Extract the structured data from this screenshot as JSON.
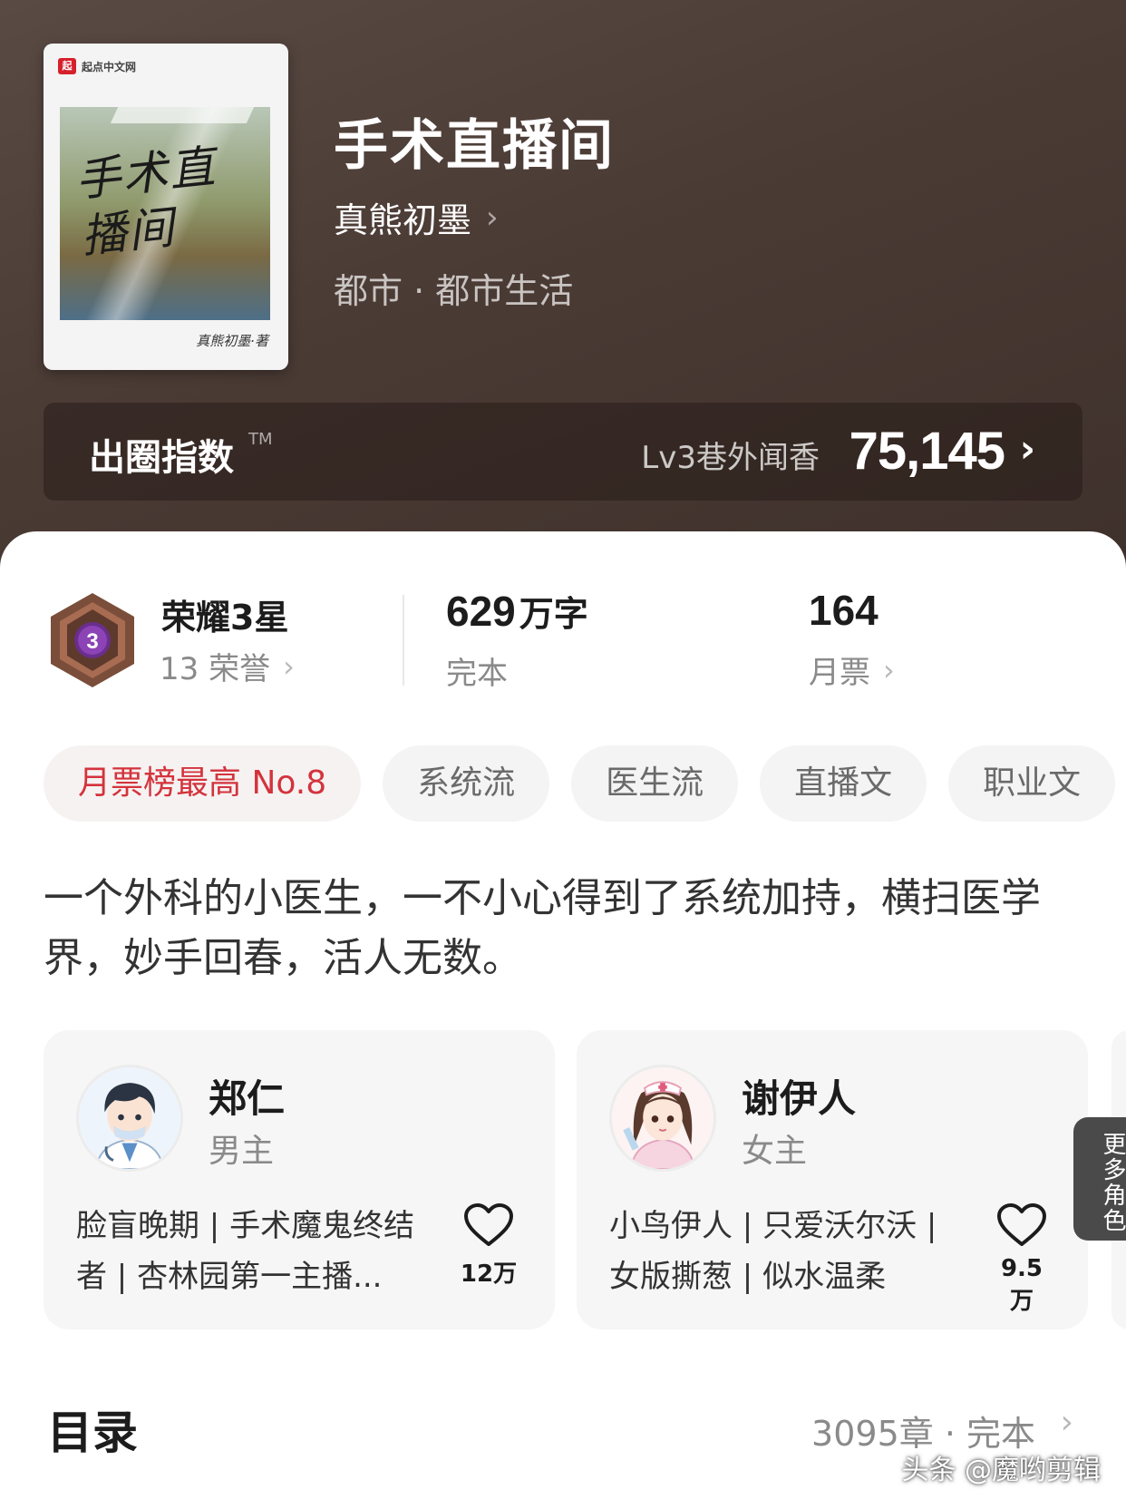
{
  "book": {
    "title": "手术直播间",
    "author": "真熊初墨",
    "genre": "都市 · 都市生活",
    "cover": {
      "brand": "起点中文网",
      "title": "手术直播间",
      "author_sign": "真熊初墨·著"
    }
  },
  "circle_index": {
    "label": "出圈指数",
    "tm": "TM",
    "level": "Lv3巷外闻香",
    "score": "75,145"
  },
  "stats": {
    "honor_title": "荣耀3星",
    "honor_badge_number": "3",
    "honor_count": "13 荣誉",
    "words_value": "629",
    "words_unit": "万字",
    "words_label": "完本",
    "monthly_value": "164",
    "monthly_label": "月票"
  },
  "tags": [
    {
      "label": "月票榜最高 No.8",
      "highlight": true
    },
    {
      "label": "系统流",
      "highlight": false
    },
    {
      "label": "医生流",
      "highlight": false
    },
    {
      "label": "直播文",
      "highlight": false
    },
    {
      "label": "职业文",
      "highlight": false
    }
  ],
  "synopsis": "一个外科的小医生，一不小心得到了系统加持，横扫医学界，妙手回春，活人无数。",
  "characters": [
    {
      "name": "郑仁",
      "role": "男主",
      "desc": "脸盲晚期 | 手术魔鬼终结者 | 杏林园第一主播...",
      "likes": "12万"
    },
    {
      "name": "谢伊人",
      "role": "女主",
      "desc": "小鸟伊人 | 只爱沃尔沃 | 女版撕葱 | 似水温柔",
      "likes": "9.5万"
    }
  ],
  "more_roles": "更多角色",
  "toc": {
    "title": "目录",
    "info": "3095章 · 完本"
  },
  "watermark": "头条 @魔哟剪辑",
  "colors": {
    "header_bg": "#4b3b35",
    "accent_red": "#d4333c",
    "tag_bg": "#f4f4f4"
  }
}
